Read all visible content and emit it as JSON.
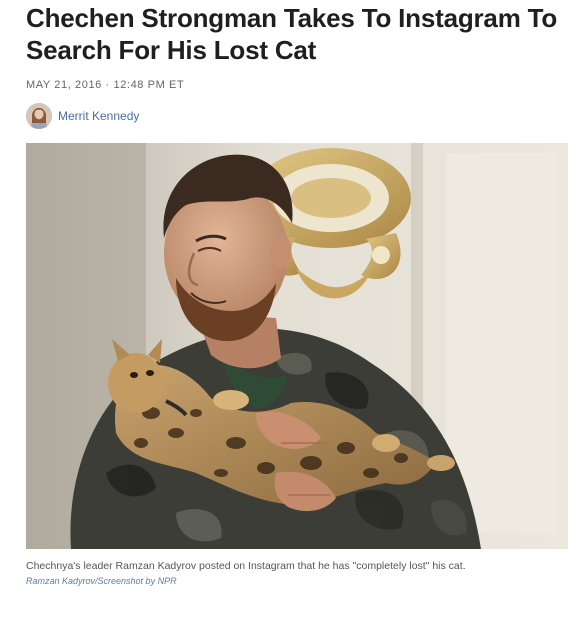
{
  "article": {
    "headline": "Chechen Strongman Takes To Instagram To Search For His Lost Cat",
    "dateline": "MAY 21, 2016 · 12:48 PM ET",
    "author": "Merrit Kennedy"
  },
  "photo": {
    "caption": "Chechnya's leader Ramzan Kadyrov posted on Instagram that he has \"completely lost\" his cat.",
    "credit": "Ramzan Kadyrov/Screenshot by NPR"
  },
  "colors": {
    "link": "#4b6d9a",
    "credit": "#5a7ca8",
    "meta": "#666666"
  }
}
